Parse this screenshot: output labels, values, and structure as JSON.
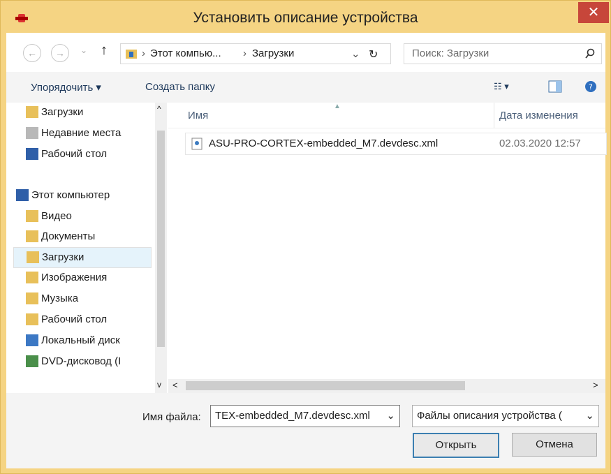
{
  "window": {
    "title": "Установить описание устройства",
    "close": "✕"
  },
  "nav": {
    "back": "←",
    "forward": "→",
    "up": "↑",
    "recent": "⌄",
    "breadcrumb": [
      "Этот компью...",
      "Загрузки"
    ],
    "refresh": "↻",
    "search_placeholder": "Поиск: Загрузки"
  },
  "toolbar": {
    "organize": "Упорядочить ▾",
    "new_folder": "Создать папку"
  },
  "tree": [
    {
      "label": "Загрузки",
      "icon": "downloads-folder-icon"
    },
    {
      "label": "Недавние места",
      "icon": "recent-places-icon"
    },
    {
      "label": "Рабочий стол",
      "icon": "desktop-icon"
    },
    {
      "label": "Этот компьютер",
      "icon": "computer-icon"
    },
    {
      "label": "Видео",
      "icon": "video-folder-icon"
    },
    {
      "label": "Документы",
      "icon": "documents-folder-icon"
    },
    {
      "label": "Загрузки",
      "icon": "downloads-folder-icon"
    },
    {
      "label": "Изображения",
      "icon": "pictures-folder-icon"
    },
    {
      "label": "Музыка",
      "icon": "music-folder-icon"
    },
    {
      "label": "Рабочий стол",
      "icon": "desktop-folder-icon"
    },
    {
      "label": "Локальный диск",
      "icon": "local-disk-icon"
    },
    {
      "label": "DVD-дисковод (I",
      "icon": "dvd-drive-icon"
    }
  ],
  "list": {
    "col_name": "Имя",
    "col_date": "Дата изменения",
    "files": [
      {
        "name": "ASU-PRO-CORTEX-embedded_M7.devdesc.xml",
        "date": "02.03.2020 12:57"
      }
    ]
  },
  "bottom": {
    "filename_label": "Имя файла:",
    "filename_value": "TEX-embedded_M7.devdesc.xml",
    "filetype_value": "Файлы описания устройства (",
    "open": "Открыть",
    "cancel": "Отмена"
  }
}
